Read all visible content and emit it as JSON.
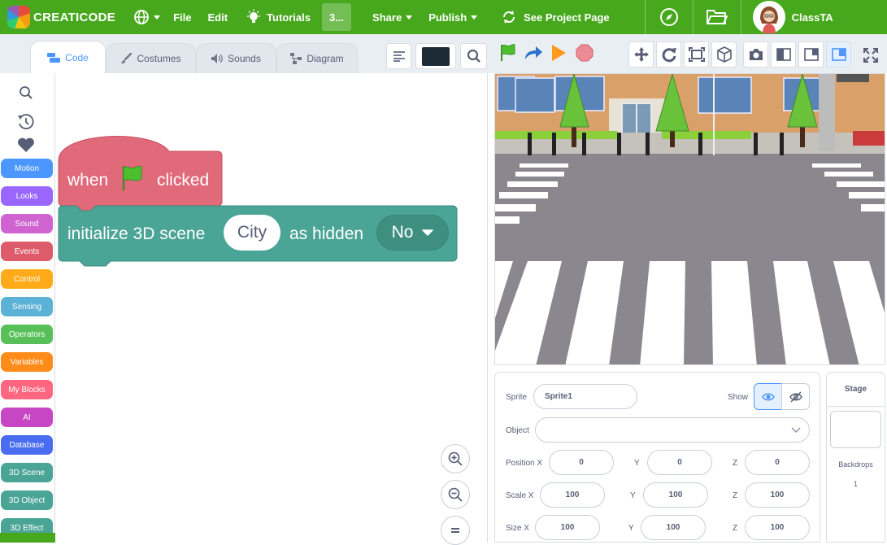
{
  "menubar": {
    "brand": "CREATICODE",
    "file": "File",
    "edit": "Edit",
    "tutorials": "Tutorials",
    "project_title": "3...",
    "share": "Share",
    "publish": "Publish",
    "see_project_page": "See Project Page",
    "username": "ClassTA"
  },
  "tabs": {
    "code": "Code",
    "costumes": "Costumes",
    "sounds": "Sounds",
    "diagram": "Diagram"
  },
  "categories": [
    {
      "label": "Motion",
      "color": "#4c97ff"
    },
    {
      "label": "Looks",
      "color": "#9966ff"
    },
    {
      "label": "Sound",
      "color": "#cf63cf"
    },
    {
      "label": "Events",
      "color": "#de5b6b"
    },
    {
      "label": "Control",
      "color": "#ffab19"
    },
    {
      "label": "Sensing",
      "color": "#5cb1d6"
    },
    {
      "label": "Operators",
      "color": "#59c059"
    },
    {
      "label": "Variables",
      "color": "#ff8c1a"
    },
    {
      "label": "My Blocks",
      "color": "#ff6680"
    },
    {
      "label": "AI",
      "color": "#c746c4"
    },
    {
      "label": "Database",
      "color": "#4a6cf0"
    },
    {
      "label": "3D Scene",
      "color": "#4ba596"
    },
    {
      "label": "3D Object",
      "color": "#4ba596"
    },
    {
      "label": "3D Effect",
      "color": "#4ba596"
    }
  ],
  "blocks": {
    "hat": {
      "when": "when",
      "clicked": "clicked",
      "color": "#e0697a"
    },
    "init": {
      "prefix": "initialize 3D scene",
      "scene": "City",
      "middle": "as hidden",
      "hidden_value": "No",
      "color": "#4ba596"
    }
  },
  "sprite_panel": {
    "sprite_label": "Sprite",
    "sprite_name": "Sprite1",
    "show_label": "Show",
    "object_label": "Object",
    "object_value": "",
    "position_x_label": "Position X",
    "y_label": "Y",
    "z_label": "Z",
    "position": {
      "x": "0",
      "y": "0",
      "z": "0"
    },
    "scale_x_label": "Scale X",
    "scale": {
      "x": "100",
      "y": "100",
      "z": "100"
    },
    "size_x_label": "Size X",
    "size": {
      "x": "100",
      "y": "100",
      "z": "100"
    }
  },
  "stage_panel": {
    "title": "Stage",
    "backdrops_label": "Backdrops",
    "backdrops_count": "1"
  },
  "colors": {
    "brand_green": "#47a81d",
    "accent_blue": "#4c97ff"
  }
}
